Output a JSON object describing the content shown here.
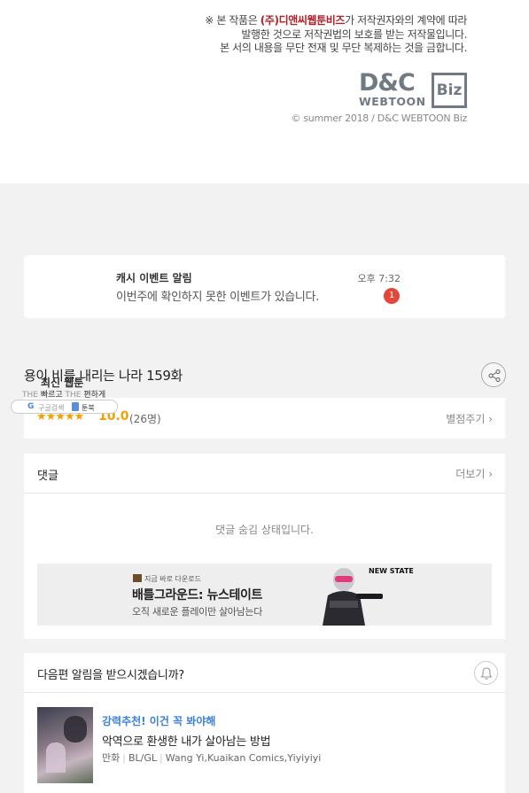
{
  "copyright": {
    "line1_prefix": "※ 본 작품은 ",
    "line1_company": "(주)디앤씨웹툰비즈",
    "line1_suffix": "가 저작권자와의 계약에 따라",
    "line2": "발행한 것으로 저작권법의 보호를 받는 저작물입니다.",
    "line3": "본 서의 내용을 무단 전재 및 무단 복제하는 것을 금합니다.",
    "logo_dc": "D&C",
    "logo_webtoon": "WEBTOON",
    "logo_biz": "Biz",
    "small": "© summer 2018 / D&C WEBTOON Biz"
  },
  "notification": {
    "title": "캐시 이벤트 알림",
    "body": "이번주에 확인하지 못한 이벤트가 있습니다.",
    "time": "오후 7:32",
    "badge": "1"
  },
  "episode": {
    "title": "용이 비를 내리는 나라 159화"
  },
  "overlay": {
    "title": "최신 웹툰",
    "sub_light1": "THE",
    "sub_bold1": "빠르고",
    "sub_light2": "THE",
    "sub_bold2": "편하게",
    "google": "G",
    "search": "구글검색",
    "mybook": "툰북"
  },
  "rating": {
    "stars": "★★★★★",
    "score": "10.0",
    "votes": "(26명)",
    "link": "별점주기 ›"
  },
  "comments": {
    "title": "댓글",
    "more": "더보기 ›",
    "hidden_message": "댓글 숨김 상태입니다."
  },
  "ad": {
    "small": "지금 바로 다운로드",
    "title": "배틀그라운드: 뉴스테이트",
    "subtitle": "오직 새로운 플레이만 살아남는다",
    "logo": "NEW STATE"
  },
  "next_alert": {
    "title": "다음편 알림을 받으시겠습니까?"
  },
  "recommendation": {
    "badge": "강력추천! 이건 꼭 봐야해",
    "title": "악역으로 환생한 내가 살아남는 방법",
    "genre1": "만화",
    "genre2": "BL/GL",
    "authors": "Wang Yi,Kuaikan Comics,Yiyiyiyi"
  },
  "colors": {
    "accent_orange": "#f2a200",
    "badge_red": "#e4473a",
    "brand_red": "#b2202a",
    "rec_blue": "#3b7fe0"
  }
}
